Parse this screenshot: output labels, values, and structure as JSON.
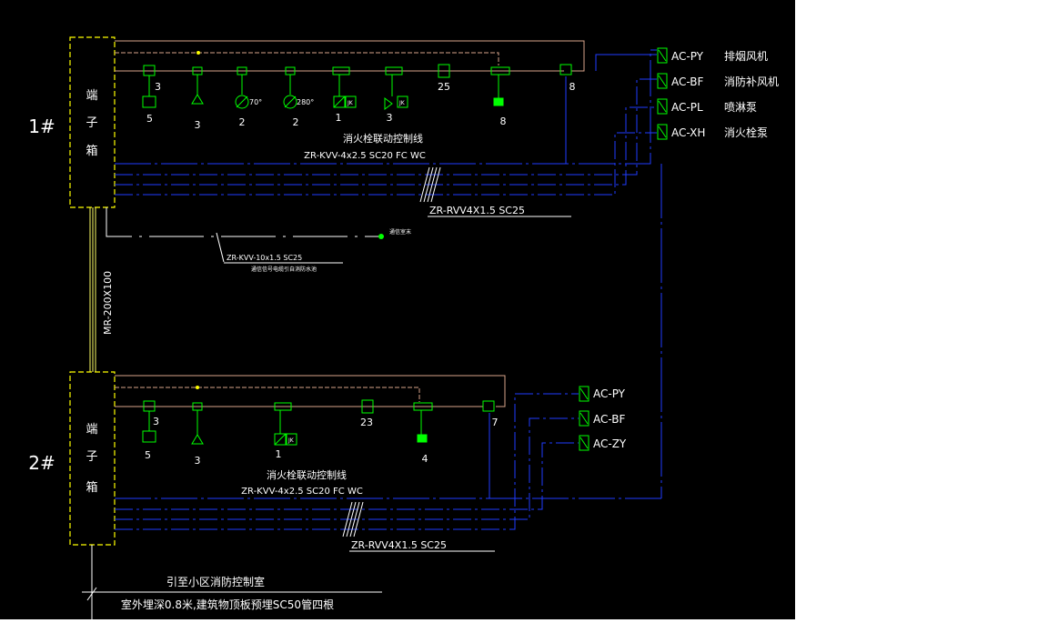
{
  "colors": {
    "bg": "#000000",
    "device": "#00ff00",
    "box": "#ffff00",
    "blue": "#1f3dff",
    "bus": "#d8a58a",
    "text": "#ffffff",
    "cabinet_frame": "#ffff66"
  },
  "floors": [
    {
      "label": "1#",
      "box_chars": [
        "端",
        "子",
        "箱"
      ],
      "device_counts": [
        "3",
        "5",
        "3",
        "2",
        "2",
        "1",
        "3",
        "25",
        "8",
        "8"
      ],
      "device_marks": [
        "70°",
        "280°",
        "JK",
        "JK"
      ],
      "cable_title": "消火栓联动控制线",
      "cable_spec": "ZR-KVV-4x2.5  SC20  FC  WC",
      "rvv_spec": "ZR-RVV4X1.5  SC25",
      "modules": [
        {
          "code": "AC-PY",
          "desc": "排烟风机"
        },
        {
          "code": "AC-BF",
          "desc": "消防补风机"
        },
        {
          "code": "AC-PL",
          "desc": "喷淋泵"
        },
        {
          "code": "AC-XH",
          "desc": "消火栓泵"
        }
      ]
    },
    {
      "label": "2#",
      "box_chars": [
        "端",
        "子",
        "箱"
      ],
      "device_counts": [
        "3",
        "5",
        "3",
        "1",
        "23",
        "4",
        "7"
      ],
      "device_marks": [
        "JK"
      ],
      "cable_title": "消火栓联动控制线",
      "cable_spec": "ZR-KVV-4x2.5  SC20  FC  WC",
      "rvv_spec": "ZR-RVV4X1.5  SC25",
      "modules": [
        {
          "code": "AC-PY",
          "desc": ""
        },
        {
          "code": "AC-BF",
          "desc": ""
        },
        {
          "code": "AC-ZY",
          "desc": ""
        }
      ]
    }
  ],
  "riser_label": "MR-200X100",
  "branch": {
    "end_label": "通信室末",
    "cable": "ZR-KVV-10x1.5  SC25",
    "note": "通信信号电缆引自消防水池"
  },
  "footer": {
    "line1": "引至小区消防控制室",
    "line2": "室外埋深0.8米,建筑物顶板预埋SC50管四根"
  }
}
